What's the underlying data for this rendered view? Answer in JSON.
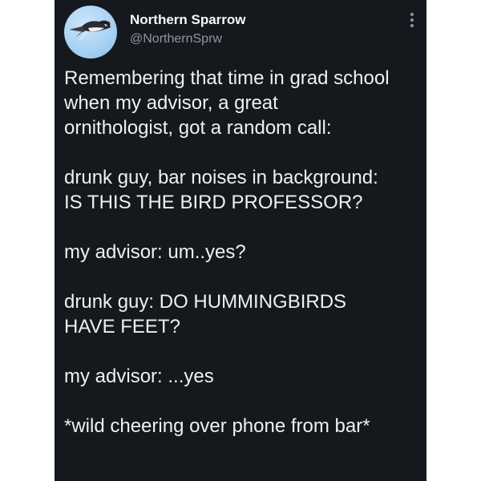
{
  "tweet": {
    "author": {
      "display_name": "Northern Sparrow",
      "handle": "@NorthernSprw",
      "avatar_icon": "bird-avatar-icon"
    },
    "more_icon": "more-options-icon",
    "paragraphs": [
      "Remembering that time in grad school\nwhen my advisor, a great\nornithologist, got a random call:",
      "drunk guy, bar noises in background:\nIS THIS THE BIRD PROFESSOR?",
      "my advisor: um..yes?",
      "drunk guy: DO HUMMINGBIRDS\nHAVE FEET?",
      "my advisor: ...yes",
      "*wild cheering over phone from bar*"
    ]
  },
  "colors": {
    "background": "#15181c",
    "text": "#e7e9ea",
    "secondary_text": "#8b98a5",
    "avatar_sky": "#a9d2f3"
  }
}
